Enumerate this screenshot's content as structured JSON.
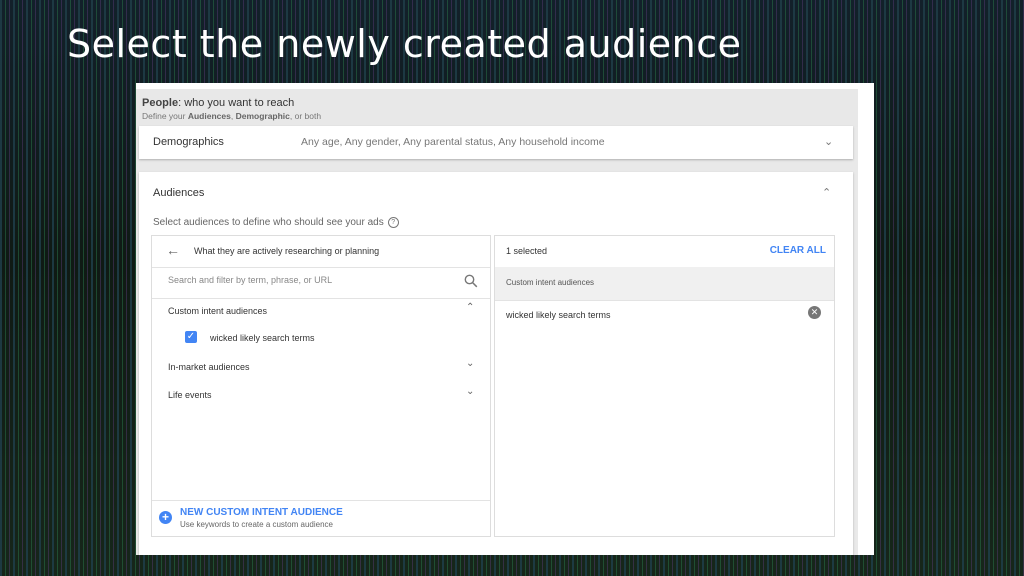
{
  "slide": {
    "title": "Select the newly created audience"
  },
  "people": {
    "label": "People",
    "subtitle": ": who you want to reach",
    "define_prefix": "Define your ",
    "define_audiences": "Audiences",
    "define_sep": ", ",
    "define_demographic": "Demographic",
    "define_suffix": ", or both"
  },
  "demographics": {
    "label": "Demographics",
    "value": "Any age, Any gender, Any parental status, Any household income",
    "icon": "chevron-down-icon"
  },
  "audiences": {
    "title": "Audiences",
    "help_text": "Select audiences to define who should see your ads",
    "help_icon": "?",
    "left": {
      "header": "What they are actively researching or planning",
      "search_placeholder": "Search and filter by term, phrase, or URL",
      "search_value": "",
      "categories": [
        {
          "label": "Custom intent audiences",
          "expanded": true
        },
        {
          "label": "In-market audiences",
          "expanded": false
        },
        {
          "label": "Life events",
          "expanded": false
        }
      ],
      "checked_item": {
        "label": "wicked likely search terms",
        "checked": true
      },
      "new_title": "NEW CUSTOM INTENT AUDIENCE",
      "new_subtitle": "Use keywords to create a custom audience"
    },
    "right": {
      "count": "1 selected",
      "clear_all": "CLEAR ALL",
      "section": "Custom intent audiences",
      "items": [
        "wicked likely search terms"
      ]
    }
  },
  "colors": {
    "accent": "#4285f4",
    "panel_grey": "#e9e9e9"
  }
}
